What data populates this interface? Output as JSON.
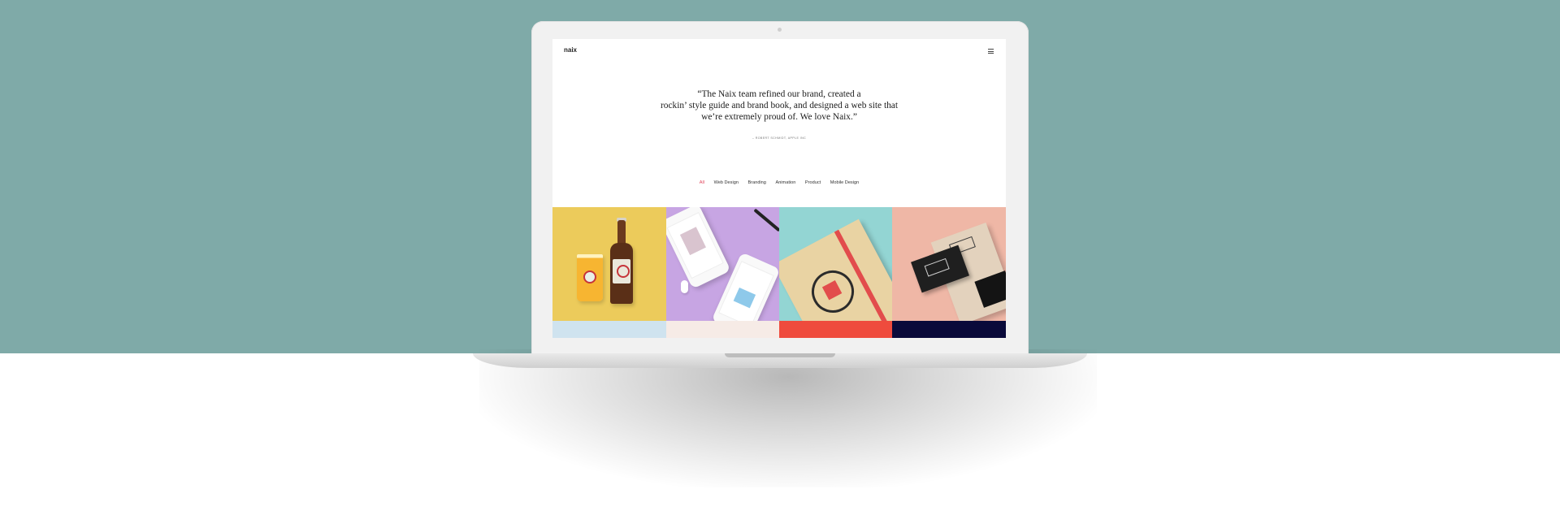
{
  "colors": {
    "backdrop": "#7faaa8",
    "filter_active": "#e0455b"
  },
  "nav": {
    "logo": "naix",
    "menu_icon": "hamburger-menu-icon"
  },
  "testimonial": {
    "quote_lines": [
      "“The Naix team refined our brand, created a",
      "rockin’ style guide and brand book, and designed a web site that",
      "we’re extremely proud of. We love Naix.”"
    ],
    "author": "– ROBERT SCHMIDT, APPLE INC"
  },
  "filters": {
    "items": [
      "All",
      "Web Design",
      "Branding",
      "Animation",
      "Product",
      "Mobile Design"
    ],
    "active": "All"
  },
  "portfolio": {
    "tiles": [
      {
        "subject": "beer bottle and glass mockup",
        "color": "#eccb5b"
      },
      {
        "subject": "phones app mockup",
        "color": "#c7a5e3"
      },
      {
        "subject": "notebook mockup",
        "color": "#93d5d3"
      },
      {
        "subject": "business card box mockup",
        "color": "#efb7a6"
      }
    ],
    "second_row_colors": [
      "#cfe3ef",
      "#f6ebe6",
      "#ef4b3d",
      "#0a0a3a"
    ]
  }
}
